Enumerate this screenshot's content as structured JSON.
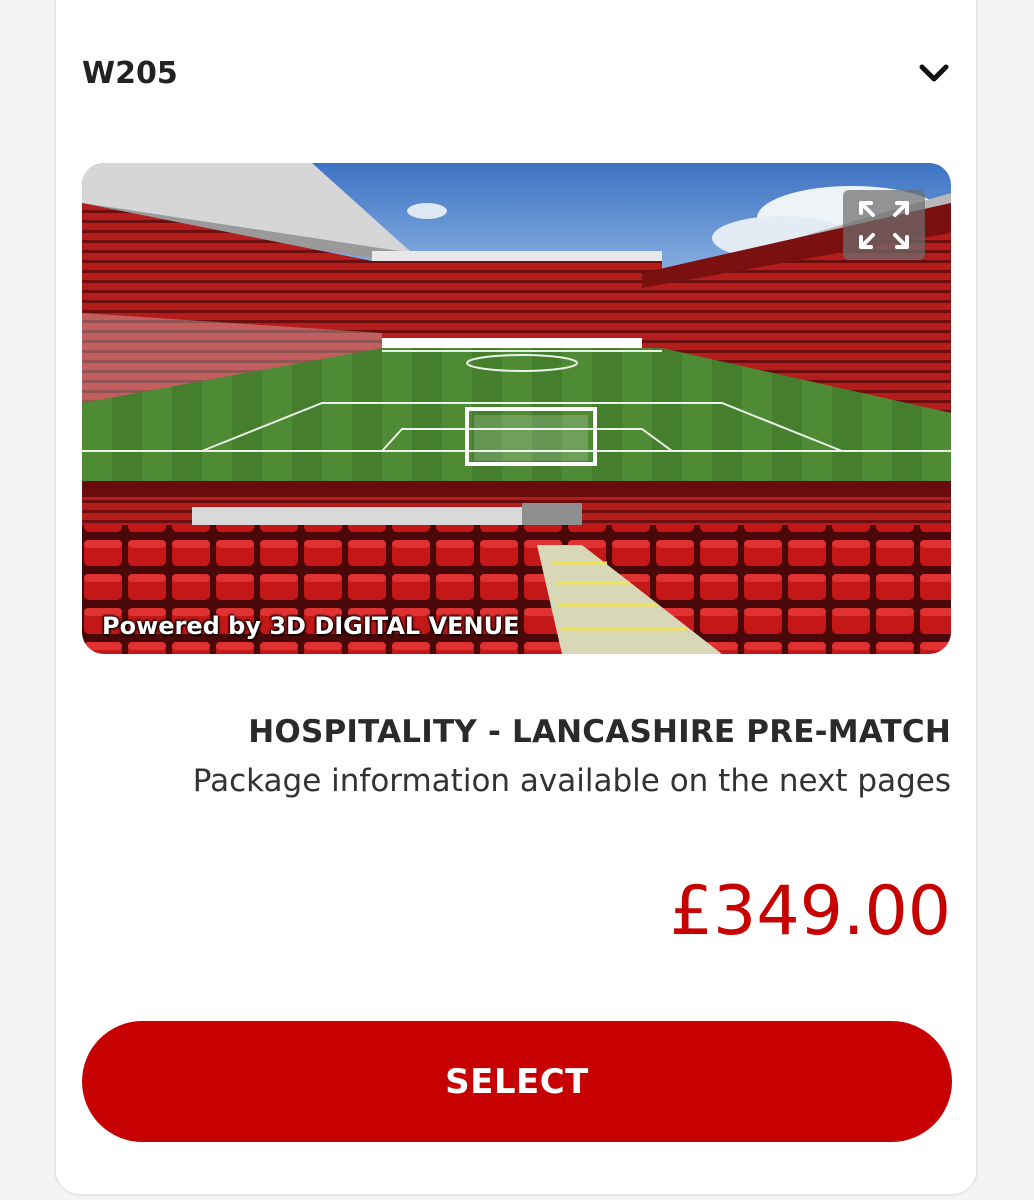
{
  "section": {
    "code": "W205",
    "toggle_icon": "chevron-down-icon"
  },
  "view": {
    "attribution": "Powered by 3D DIGITAL VENUE",
    "expand_icon": "expand-icon"
  },
  "package": {
    "title": "HOSPITALITY - LANCASHIRE PRE-MATCH",
    "subtitle": "Package information available on the next pages",
    "price": "£349.00"
  },
  "actions": {
    "select_label": "SELECT"
  },
  "colors": {
    "accent": "#c70101",
    "price": "#c70000"
  }
}
